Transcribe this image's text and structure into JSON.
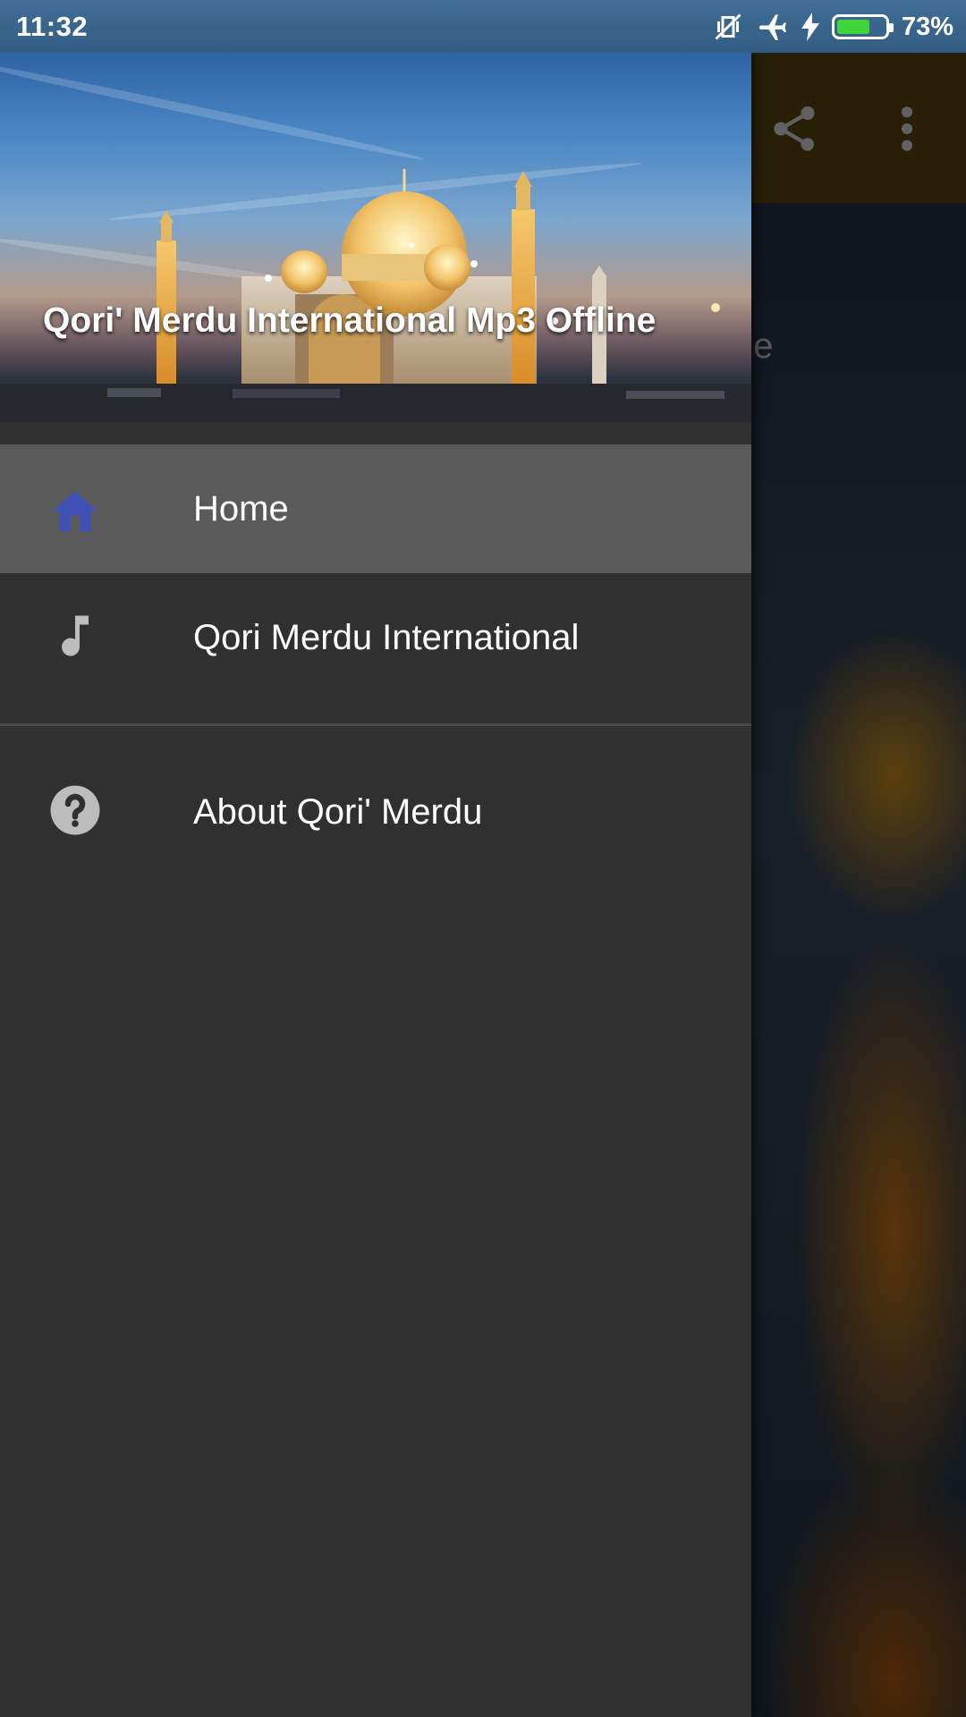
{
  "status_bar": {
    "time": "11:32",
    "battery_percent_label": "73%",
    "battery_level": 0.73,
    "icons": [
      "vibrate-off-icon",
      "airplane-icon",
      "charging-bolt-icon",
      "battery-icon"
    ]
  },
  "background_app": {
    "toolbar_color": "#6b5210",
    "partial_text": "ne",
    "icons": [
      "share-icon",
      "more-vert-icon"
    ]
  },
  "drawer": {
    "header_title": "Qori' Merdu International Mp3 Offline",
    "items": [
      {
        "label": "Home",
        "icon": "home-icon",
        "active": true,
        "icon_color": "#3f51b5"
      },
      {
        "label": "Qori Merdu International",
        "icon": "music-note-icon",
        "active": false,
        "icon_color": "#bdbdbd"
      },
      {
        "label": "About Qori' Merdu",
        "icon": "help-circle-icon",
        "active": false,
        "icon_color": "#bdbdbd"
      }
    ]
  },
  "colors": {
    "drawer_bg": "#303030",
    "active_item_bg": "#5a5a5a",
    "accent": "#3f51b5"
  }
}
